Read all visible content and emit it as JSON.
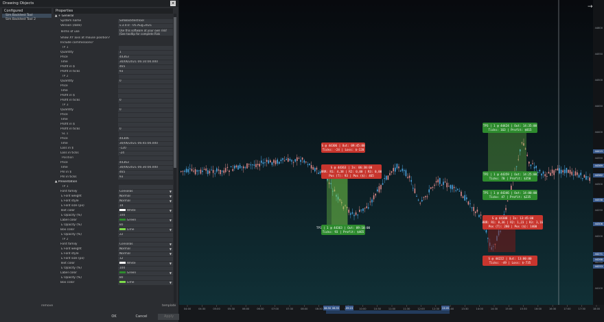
{
  "dialog": {
    "title": "Drawing Objects",
    "left_header": "Configured",
    "left_items": [
      "Sim Backtest Tool",
      "Sim Backtest Tool 2"
    ],
    "remove_label": "remove",
    "properties_header": "Properties",
    "import_label": "template",
    "ok_label": "OK",
    "cancel_label": "Cancel",
    "apply_label": "Apply"
  },
  "properties": [
    {
      "label": "▲ + General",
      "value": "",
      "kind": "section"
    },
    {
      "label": "System name",
      "value": "SimBacktestTool"
    },
    {
      "label": "Version (date)",
      "value": "v.3.0.0 - 05.Aug.2021"
    },
    {
      "label": "Terms of use",
      "value": "Use this software at your own risk! (See tooltip for complete Risk Disclosure)",
      "kind": "tall"
    },
    {
      "label": "Show XY axis at mouse position?",
      "value": "",
      "kind": "nobox"
    },
    {
      "label": "Include commissions?",
      "value": "",
      "kind": "nobox"
    },
    {
      "label": "TP 1",
      "value": "",
      "kind": "sub"
    },
    {
      "label": "Quantity",
      "value": "1"
    },
    {
      "label": "Price",
      "value": "44363"
    },
    {
      "label": "Time",
      "value": "30/06/2021 06:10:00.000"
    },
    {
      "label": "Profit in $",
      "value": "465"
    },
    {
      "label": "Profit in ticks",
      "value": "93"
    },
    {
      "label": "TP 2",
      "value": "",
      "kind": "sub"
    },
    {
      "label": "Quantity",
      "value": "0"
    },
    {
      "label": "Price",
      "value": ""
    },
    {
      "label": "Time",
      "value": ""
    },
    {
      "label": "Profit in $",
      "value": ""
    },
    {
      "label": "Profit in ticks",
      "value": "0"
    },
    {
      "label": "TP 3",
      "value": "",
      "kind": "sub"
    },
    {
      "label": "Quantity",
      "value": "0"
    },
    {
      "label": "Price",
      "value": ""
    },
    {
      "label": "Time",
      "value": ""
    },
    {
      "label": "Profit in $",
      "value": ""
    },
    {
      "label": "Profit in ticks",
      "value": "0"
    },
    {
      "label": "SL 1",
      "value": "",
      "kind": "sub"
    },
    {
      "label": "Price",
      "value": "44306"
    },
    {
      "label": "Time",
      "value": "30/06/2021 06:45:00.000"
    },
    {
      "label": "Loss in $",
      "value": "-120"
    },
    {
      "label": "Loss in ticks",
      "value": "-24"
    },
    {
      "label": "Position",
      "value": "",
      "kind": "sub"
    },
    {
      "label": "Price",
      "value": "44363"
    },
    {
      "label": "Time",
      "value": "30/06/2021 06:30:00.000"
    },
    {
      "label": "Pnl in $",
      "value": "465"
    },
    {
      "label": "Pnl in ticks",
      "value": "93"
    },
    {
      "label": "▲ Presentation",
      "value": "",
      "kind": "section"
    },
    {
      "label": "TP 1",
      "value": "",
      "kind": "sub"
    },
    {
      "label": "Font family",
      "value": "Consolas",
      "drop": true
    },
    {
      "label": "↳ Font weight",
      "value": "Normal",
      "drop": true
    },
    {
      "label": "↳ Font style",
      "value": "Normal",
      "drop": true
    },
    {
      "label": "↳ Font size (px)",
      "value": "14"
    },
    {
      "label": "Text color",
      "value": "White",
      "swatch": "#ffffff",
      "drop": true
    },
    {
      "label": "↳ Opacity (%)",
      "value": "100"
    },
    {
      "label": "Label color",
      "value": "Green",
      "swatch": "#2e8b2e",
      "drop": true
    },
    {
      "label": "↳ Opacity (%)",
      "value": "80"
    },
    {
      "label": "Box color",
      "value": "Lime",
      "swatch": "#7cd94a",
      "drop": true
    },
    {
      "label": "↳ Opacity (%)",
      "value": "22"
    },
    {
      "label": "TP 2",
      "value": "",
      "kind": "sub"
    },
    {
      "label": "Font family",
      "value": "Consolas",
      "drop": true
    },
    {
      "label": "↳ Font weight",
      "value": "Normal",
      "drop": true
    },
    {
      "label": "↳ Font style",
      "value": "Normal",
      "drop": true
    },
    {
      "label": "↳ Font size (px)",
      "value": "12"
    },
    {
      "label": "Text color",
      "value": "White",
      "swatch": "#ffffff",
      "drop": true
    },
    {
      "label": "↳ Opacity (%)",
      "value": "100"
    },
    {
      "label": "Label color",
      "value": "Green",
      "swatch": "#2e8b2e",
      "drop": true
    },
    {
      "label": "↳ Opacity (%)",
      "value": "80"
    },
    {
      "label": "Box color",
      "value": "Lime",
      "swatch": "#7cd94a",
      "drop": true
    }
  ],
  "chart": {
    "colors": {
      "up": "#4aa3e0",
      "down": "#e08a8a",
      "tp_label": "#2e8b2e",
      "sl_label": "#c8362e",
      "tp_box": "#7cd94a",
      "sl_box": "#7a1a1a"
    },
    "price_axis": [
      "44600",
      "44550",
      "44500",
      "44450",
      "44400",
      "44350",
      "44300",
      "44250",
      "44200",
      "44150",
      "44100"
    ],
    "price_badges": [
      "44415",
      "44369",
      "44362",
      "44338",
      "44306",
      "44271",
      "44268",
      "44253"
    ],
    "time_axis": [
      "04:00",
      "04:30",
      "05:00",
      "05:30",
      "06:00",
      "06:30",
      "07:00",
      "07:30",
      "08:00",
      "08:30",
      "09:00",
      "09:30",
      "10:00",
      "10:30",
      "11:00",
      "11:30",
      "12:00",
      "12:30",
      "13:00",
      "13:30",
      "14:00",
      "14:30",
      "15:00",
      "15:30",
      "16:00",
      "16:30",
      "17:00",
      "17:30",
      "18:00"
    ],
    "time_badges": [
      "08:50",
      "08:55",
      "09:15",
      "13:05"
    ],
    "labels_left": [
      {
        "lines": [
          "S @ 44306 | Out: 09:45:00",
          "Ticks: -24 | Loss: $-120"
        ],
        "color": "sl"
      },
      {
        "lines": [
          "S @ 44363 | In: 06:30:00",
          "RRR: R1: 4,38 | R2: 0,00 | R3: 0,00",
          "Pos (T): 93 | Pos ($): 465"
        ],
        "color": "sl"
      },
      {
        "lines": [
          "TP1 | 1 @ 44363 | Out: 09:10:00",
          "Ticks: 93 | Profit: $465"
        ],
        "color": "tp"
      }
    ],
    "labels_right": [
      {
        "lines": [
          "TP3 | 1 @ 44424 | Out: 14:35:00",
          "Ticks: 163 | Profit: $815"
        ],
        "color": "tp"
      },
      {
        "lines": [
          "TP2 | 1 @ 44359 | Out: 14:25:00",
          "Ticks: 70 | Profit: $350"
        ],
        "color": "tp"
      },
      {
        "lines": [
          "TP1 | 1 @ 44346 | Out: 14:00:00",
          "Ticks: 47 | Profit: $235"
        ],
        "color": "tp"
      },
      {
        "lines": [
          "S @ 44308 | In: 13:45:00",
          "RRR: R1: 0,36 | R2: 1,23 | R3: 3,16",
          "Pos (T): 280 | Pos ($): 1400"
        ],
        "color": "sl"
      },
      {
        "lines": [
          "S @ 44222 | Out: 13:00:00",
          "Ticks: -49 | Loss: $-735"
        ],
        "color": "sl"
      }
    ],
    "corner_icon": "arrow-right-icon"
  }
}
